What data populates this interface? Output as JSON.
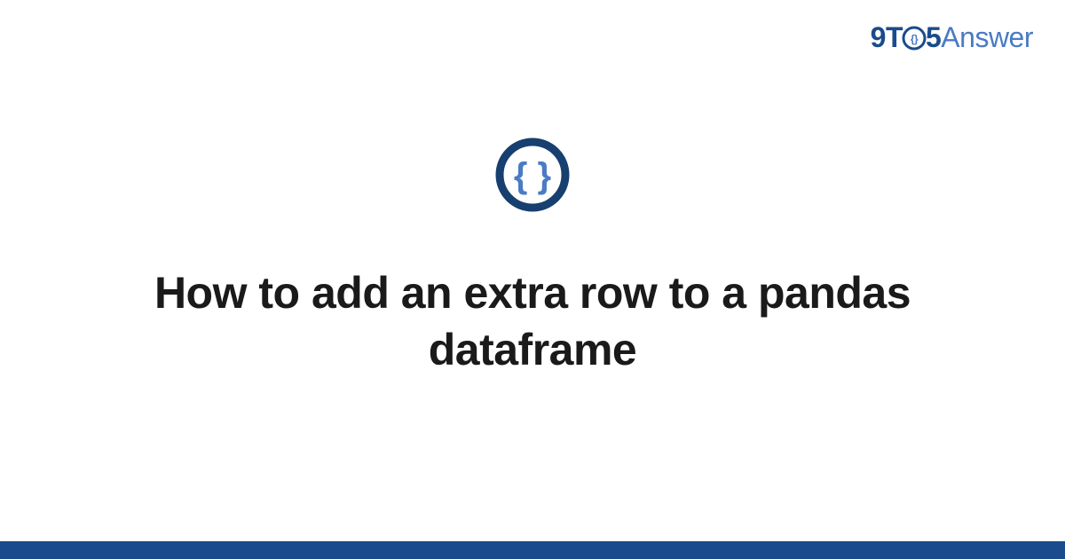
{
  "logo": {
    "prefix": "9T",
    "middle_icon": "clock-braces-icon",
    "five": "5",
    "suffix": "Answer"
  },
  "center": {
    "icon_name": "code-braces-icon",
    "heading": "How to add an extra row to a pandas dataframe"
  },
  "colors": {
    "primary_dark": "#1a4b8c",
    "primary_light": "#4a7bc4",
    "text": "#1a1a1a"
  }
}
